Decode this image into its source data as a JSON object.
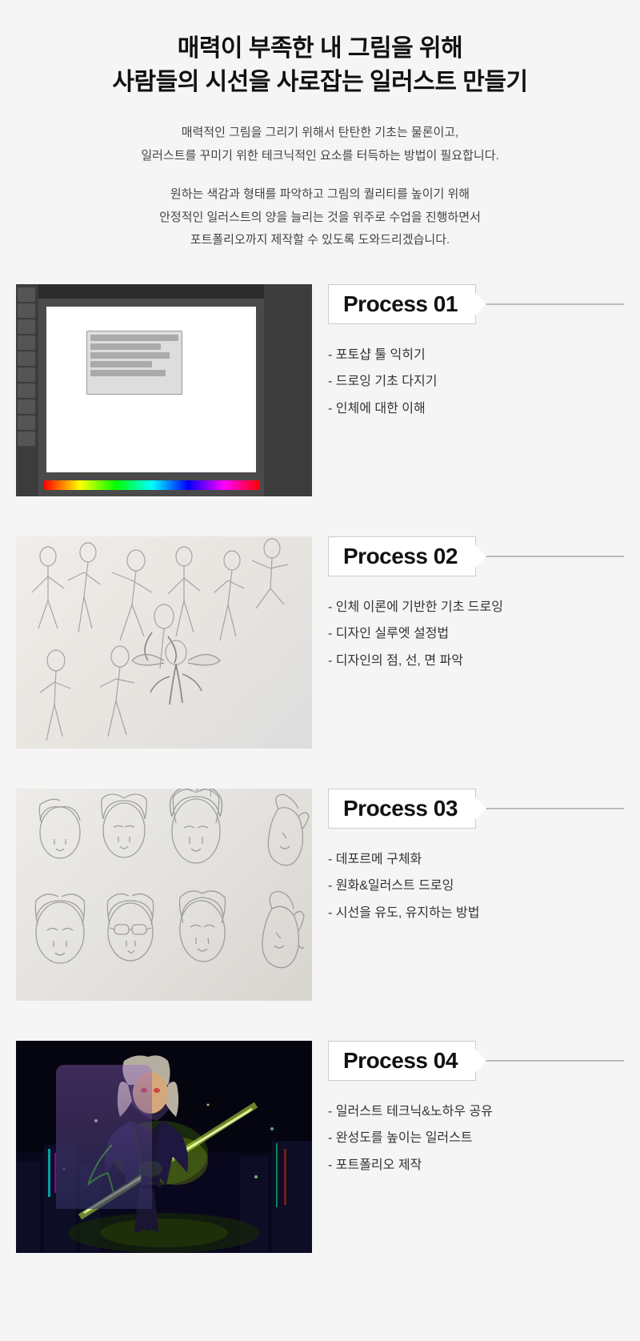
{
  "header": {
    "main_title_line1": "매력이 부족한 내 그림을 위해",
    "main_title_line2": "사람들의 시선을 사로잡는 일러스트 만들기",
    "desc1_line1": "매력적인 그림을 그리기 위해서 탄탄한 기초는 물론이고,",
    "desc1_line2": "일러스트를 꾸미기 위한 테크닉적인 요소를 터득하는 방법이 필요합니다.",
    "desc2_line1": "원하는 색감과 형태를 파악하고 그림의 퀄리티를 높이기 위해",
    "desc2_line2": "안정적인 일러스트의 양을 늘리는 것을 위주로 수업을 진행하면서",
    "desc2_line3": "포트폴리오까지 제작할 수 있도록 도와드리겠습니다."
  },
  "processes": [
    {
      "id": "p01",
      "title": "Process 01",
      "items": [
        "- 포토샵 툴 익히기",
        "- 드로잉 기초 다지기",
        "- 인체에 대한 이해"
      ],
      "image_type": "photoshop"
    },
    {
      "id": "p02",
      "title": "Process 02",
      "items": [
        "- 인체 이론에 기반한 기초 드로잉",
        "- 디자인 실루엣 설정법",
        "- 디자인의 점, 선, 면 파악"
      ],
      "image_type": "sketch"
    },
    {
      "id": "p03",
      "title": "Process 03",
      "items": [
        "- 데포르메 구체화",
        "- 원화&일러스트 드로잉",
        "- 시선을 유도, 유지하는 방법"
      ],
      "image_type": "face_sketch"
    },
    {
      "id": "p04",
      "title": "Process 04",
      "items": [
        "- 일러스트 테크닉&노하우 공유",
        "- 완성도를 높이는 일러스트",
        "- 포트폴리오 제작"
      ],
      "image_type": "illustration"
    }
  ]
}
